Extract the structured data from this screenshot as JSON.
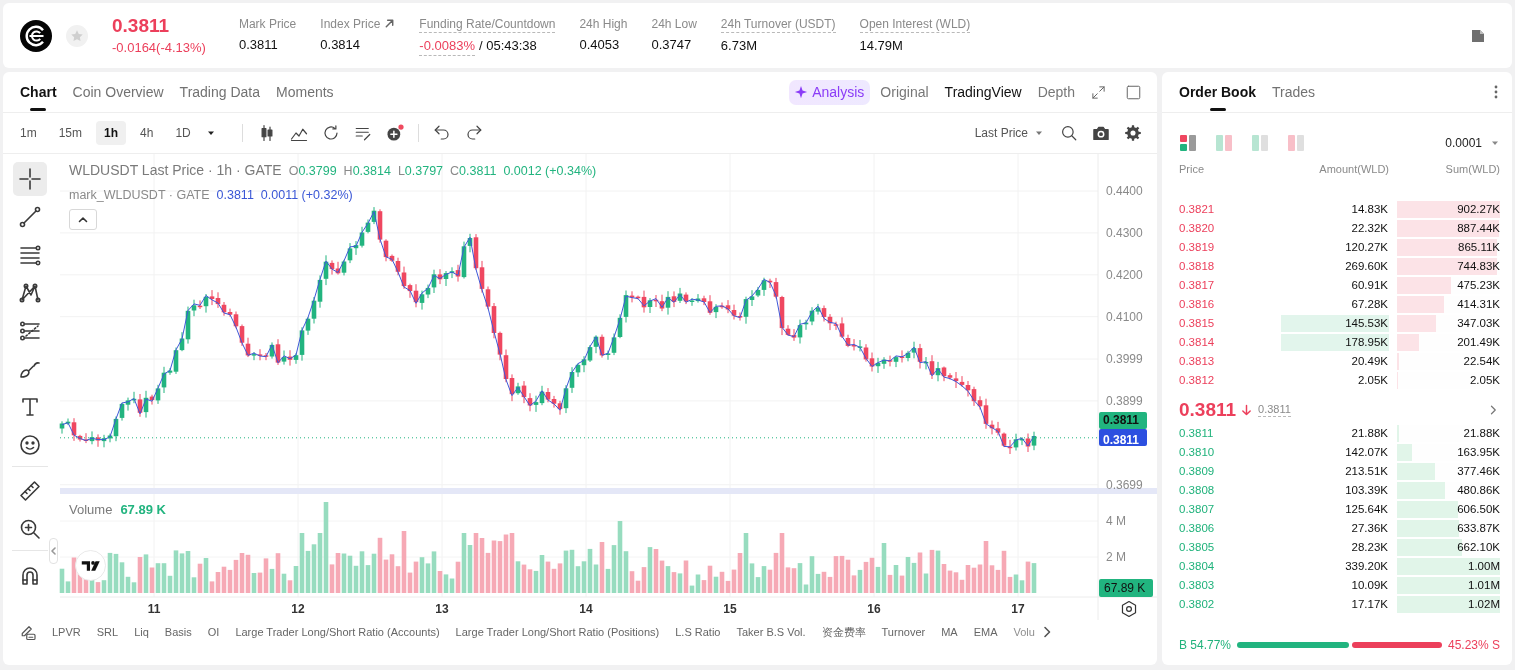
{
  "header": {
    "price": "0.3811",
    "change": "-0.0164(-4.13%)",
    "falling": true,
    "starred": false,
    "stats": [
      {
        "label": "Mark Price",
        "value": "0.3811",
        "kind": "plain"
      },
      {
        "label": "Index Price",
        "value": "0.3814",
        "kind": "link"
      },
      {
        "label": "Funding Rate/Countdown",
        "value": "-0.0083%",
        "extra": "/ 05:43:38",
        "kind": "funding",
        "negative": true
      },
      {
        "label": "24h High",
        "value": "0.4053",
        "kind": "plain"
      },
      {
        "label": "24h Low",
        "value": "0.3747",
        "kind": "plain"
      },
      {
        "label": "24h Turnover (USDT)",
        "value": "6.73M",
        "kind": "dotted"
      },
      {
        "label": "Open Interest (WLD)",
        "value": "14.79M",
        "kind": "dotted"
      }
    ]
  },
  "chart": {
    "tabs": [
      {
        "label": "Chart",
        "selected": true
      },
      {
        "label": "Coin Overview",
        "selected": false
      },
      {
        "label": "Trading Data",
        "selected": false
      },
      {
        "label": "Moments",
        "selected": false
      }
    ],
    "views": [
      {
        "label": "Analysis",
        "kind": "ai",
        "selected": false
      },
      {
        "label": "Original",
        "kind": "plain",
        "selected": false
      },
      {
        "label": "TradingView",
        "kind": "plain",
        "selected": true
      },
      {
        "label": "Depth",
        "kind": "plain",
        "selected": false
      }
    ],
    "intervals": [
      {
        "label": "1m",
        "selected": false
      },
      {
        "label": "15m",
        "selected": false
      },
      {
        "label": "1h",
        "selected": true
      },
      {
        "label": "4h",
        "selected": false
      },
      {
        "label": "1D",
        "selected": false
      }
    ],
    "price_source": "Last Price",
    "tool_groups": [
      [
        {
          "kind": "crosshair",
          "selected": true
        },
        {
          "kind": "trend-line",
          "selected": false
        },
        {
          "kind": "parallel-lines",
          "selected": false
        },
        {
          "kind": "pattern",
          "selected": false
        },
        {
          "kind": "fib",
          "selected": false
        },
        {
          "kind": "brush",
          "selected": false
        },
        {
          "kind": "text",
          "selected": false
        },
        {
          "kind": "emoji",
          "selected": false
        }
      ],
      [
        {
          "kind": "ruler",
          "selected": false
        },
        {
          "kind": "zoom",
          "selected": false
        }
      ],
      [
        {
          "kind": "magnet",
          "selected": false
        }
      ]
    ],
    "legend": {
      "title": "WLDUSDT Last Price · 1h · GATE",
      "ohlc": [
        {
          "key": "O",
          "value": "0.3799"
        },
        {
          "key": "H",
          "value": "0.3814"
        },
        {
          "key": "L",
          "value": "0.3797"
        },
        {
          "key": "C",
          "value": "0.3811"
        }
      ],
      "change": "0.0012 (+0.34%)",
      "mark_title": "mark_WLDUSDT · GATE",
      "mark_value": "0.3811",
      "mark_change": "0.0011 (+0.32%)"
    },
    "volume": {
      "label": "Volume",
      "value": "67.89 K"
    },
    "price_axis": [
      "0.4400",
      "0.4300",
      "0.4200",
      "0.4100",
      "0.3999",
      "0.3899",
      "0.3699"
    ],
    "price_tags": [
      {
        "kind": "last",
        "value": "0.3811"
      },
      {
        "kind": "mark",
        "value": "0.3811"
      }
    ],
    "volume_axis": [
      "4 M",
      "2 M"
    ],
    "volume_tag": "67.89 K",
    "time_axis": [
      "11",
      "12",
      "13",
      "14",
      "15",
      "16",
      "17"
    ],
    "indicators": [
      "LPVR",
      "SRL",
      "Liq",
      "Basis",
      "OI",
      "Large Trader Long/Short Ratio (Accounts)",
      "Large Trader Long/Short Ratio (Positions)",
      "L.S Ratio",
      "Taker B.S Vol.",
      "资金费率",
      "Turnover",
      "MA",
      "EMA",
      "Volu"
    ]
  },
  "order_book": {
    "tabs": [
      {
        "label": "Order Book",
        "selected": true
      },
      {
        "label": "Trades",
        "selected": false
      }
    ],
    "layouts": [
      {
        "kind": "both",
        "selected": true
      },
      {
        "kind": "split",
        "selected": false
      },
      {
        "kind": "bids",
        "selected": false
      },
      {
        "kind": "asks",
        "selected": false
      }
    ],
    "precision": "0.0001",
    "columns": [
      "Price",
      "Amount(WLD)",
      "Sum(WLD)"
    ],
    "asks": [
      {
        "price": "0.3821",
        "amount": "14.83K",
        "sum": "902.27K",
        "level": 1.0,
        "highlighted": false
      },
      {
        "price": "0.3820",
        "amount": "22.32K",
        "sum": "887.44K",
        "level": 0.99,
        "highlighted": false
      },
      {
        "price": "0.3819",
        "amount": "120.27K",
        "sum": "865.11K",
        "level": 0.97,
        "highlighted": false
      },
      {
        "price": "0.3818",
        "amount": "269.60K",
        "sum": "744.83K",
        "level": 0.97,
        "highlighted": false
      },
      {
        "price": "0.3817",
        "amount": "60.91K",
        "sum": "475.23K",
        "level": 0.52,
        "highlighted": false
      },
      {
        "price": "0.3816",
        "amount": "67.28K",
        "sum": "414.31K",
        "level": 0.46,
        "highlighted": false
      },
      {
        "price": "0.3815",
        "amount": "145.53K",
        "sum": "347.03K",
        "level": 0.38,
        "highlighted": true
      },
      {
        "price": "0.3814",
        "amount": "178.95K",
        "sum": "201.49K",
        "level": 0.21,
        "highlighted": true
      },
      {
        "price": "0.3813",
        "amount": "20.49K",
        "sum": "22.54K",
        "level": 0.02,
        "highlighted": false
      },
      {
        "price": "0.3812",
        "amount": "2.05K",
        "sum": "2.05K",
        "level": 0.01,
        "highlighted": false
      }
    ],
    "last": {
      "price": "0.3811",
      "falling": true,
      "mark": "0.3811"
    },
    "bids": [
      {
        "price": "0.3811",
        "amount": "21.88K",
        "sum": "21.88K",
        "level": 0.02
      },
      {
        "price": "0.3810",
        "amount": "142.07K",
        "sum": "163.95K",
        "level": 0.15
      },
      {
        "price": "0.3809",
        "amount": "213.51K",
        "sum": "377.46K",
        "level": 0.37
      },
      {
        "price": "0.3808",
        "amount": "103.39K",
        "sum": "480.86K",
        "level": 0.47
      },
      {
        "price": "0.3807",
        "amount": "125.64K",
        "sum": "606.50K",
        "level": 0.59
      },
      {
        "price": "0.3806",
        "amount": "27.36K",
        "sum": "633.87K",
        "level": 0.6
      },
      {
        "price": "0.3805",
        "amount": "28.23K",
        "sum": "662.10K",
        "level": 0.63
      },
      {
        "price": "0.3804",
        "amount": "339.20K",
        "sum": "1.00M",
        "level": 1.0
      },
      {
        "price": "0.3803",
        "amount": "10.09K",
        "sum": "1.01M",
        "level": 1.0
      },
      {
        "price": "0.3802",
        "amount": "17.17K",
        "sum": "1.02M",
        "level": 1.0
      }
    ],
    "ratio": {
      "buy": "B 54.77%",
      "sell": "45.23% S",
      "level": 0.5477
    }
  }
}
